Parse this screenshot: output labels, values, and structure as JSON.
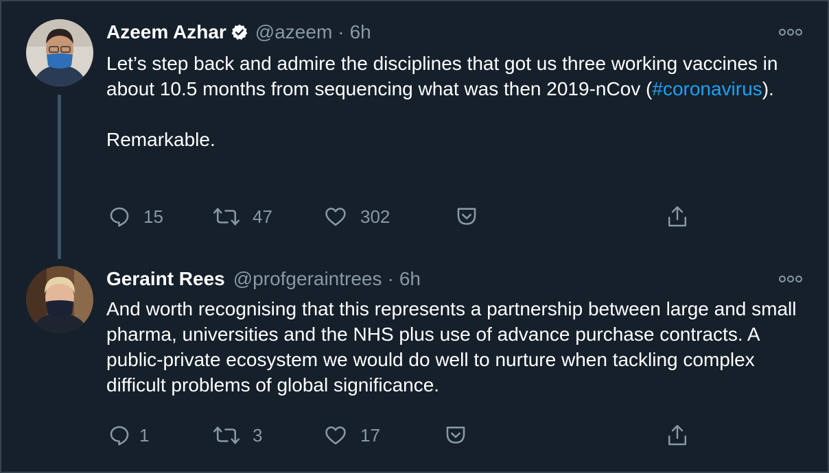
{
  "tweets": [
    {
      "author_name": "Azeem Azhar",
      "verified": true,
      "handle": "@azeem",
      "separator": "·",
      "time": "6h",
      "text_before_hashtag": "Let’s step back and admire the disciplines that got us three working vaccines in about 10.5 months from sequencing what was then 2019-nCov (",
      "hashtag": "#coronavirus",
      "text_after_hashtag": ").",
      "text_line2": "Remarkable.",
      "replies": "15",
      "retweets": "47",
      "likes": "302"
    },
    {
      "author_name": "Geraint Rees",
      "verified": false,
      "handle": "@profgeraintrees",
      "separator": "·",
      "time": "6h",
      "text": "And worth recognising that this represents a partnership between large and small pharma, universities and the NHS plus use of advance purchase contracts. A public-private ecosystem we would do well to nurture when tackling complex difficult problems of global significance.",
      "replies": "1",
      "retweets": "3",
      "likes": "17"
    }
  ],
  "colors": {
    "background": "#15202b",
    "text": "#ffffff",
    "secondary_text": "#8899a6",
    "link": "#1da1f2",
    "thread_line": "#3d5466"
  },
  "icons": [
    "verified-badge-icon",
    "more-icon",
    "reply-icon",
    "retweet-icon",
    "like-icon",
    "pocket-icon",
    "share-icon"
  ]
}
